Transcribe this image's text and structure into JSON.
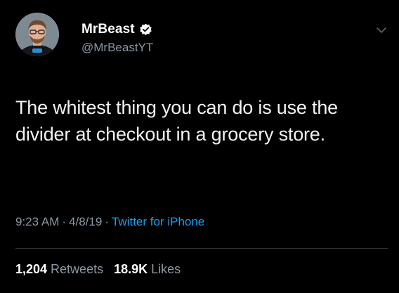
{
  "author": {
    "display_name": "MrBeast",
    "handle": "@MrBeastYT",
    "verified": true
  },
  "tweet": {
    "text": "The whitest thing you can do is use the divider at checkout in a grocery store.",
    "time": "9:23 AM",
    "date": "4/8/19",
    "source": "Twitter for iPhone",
    "separator": "·"
  },
  "stats": {
    "retweets_count": "1,204",
    "retweets_label": "Retweets",
    "likes_count": "18.9K",
    "likes_label": "Likes"
  },
  "colors": {
    "background": "#000000",
    "text": "#f2f2f2",
    "secondary_text": "#8b98a5",
    "link": "#1d9bf0",
    "divider": "#2f3336"
  },
  "icons": {
    "verified": "verified-badge-icon",
    "menu": "chevron-down-icon"
  }
}
